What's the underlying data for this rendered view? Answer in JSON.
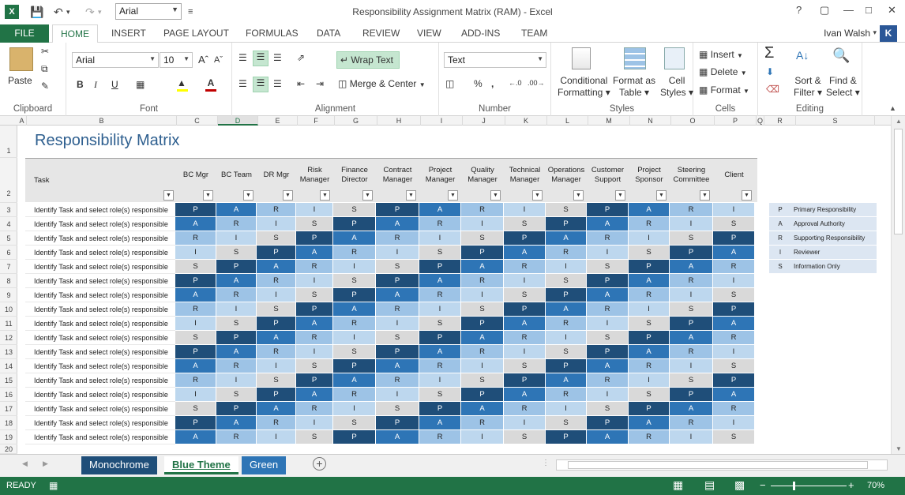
{
  "window": {
    "title": "Responsibility Assignment Matrix (RAM) - Excel",
    "help": "?",
    "restore": "▢",
    "minimize": "—",
    "maximize": "□",
    "close": "✕"
  },
  "namebox": {
    "value": "Arial"
  },
  "qat": {
    "app_icon": "X"
  },
  "ribbon_tabs": [
    {
      "label": "FILE"
    },
    {
      "label": "HOME"
    },
    {
      "label": "INSERT"
    },
    {
      "label": "PAGE LAYOUT"
    },
    {
      "label": "FORMULAS"
    },
    {
      "label": "DATA"
    },
    {
      "label": "REVIEW"
    },
    {
      "label": "VIEW"
    },
    {
      "label": "ADD-INS"
    },
    {
      "label": "TEAM"
    }
  ],
  "user": {
    "name": "Ivan Walsh",
    "initial": "K"
  },
  "groups": {
    "clipboard": {
      "label": "Clipboard",
      "paste": "Paste"
    },
    "font": {
      "label": "Font",
      "family": "Arial",
      "size": "10",
      "bold": "B",
      "italic": "I",
      "underline": "U"
    },
    "alignment": {
      "label": "Alignment",
      "wrap": "Wrap Text",
      "merge": "Merge & Center"
    },
    "number": {
      "label": "Number",
      "format": "Text",
      "percent": "%",
      "comma": ","
    },
    "styles": {
      "label": "Styles",
      "conditional": "Conditional",
      "conditional2": "Formatting",
      "format_table": "Format as",
      "format_table2": "Table",
      "cell_styles": "Cell",
      "cell_styles2": "Styles"
    },
    "cells": {
      "label": "Cells",
      "insert": "Insert",
      "delete": "Delete",
      "format": "Format"
    },
    "editing": {
      "label": "Editing",
      "sort": "Sort &",
      "sort2": "Filter",
      "find": "Find &",
      "find2": "Select"
    }
  },
  "columns": [
    "A",
    "B",
    "C",
    "D",
    "E",
    "F",
    "G",
    "H",
    "I",
    "J",
    "K",
    "L",
    "M",
    "N",
    "O",
    "P",
    "Q",
    "R",
    "S"
  ],
  "rows": [
    "1",
    "2",
    "3",
    "4",
    "5",
    "6",
    "7",
    "8",
    "9",
    "10",
    "11",
    "12",
    "13",
    "14",
    "15",
    "16",
    "17",
    "18",
    "19",
    "20"
  ],
  "sheet": {
    "title": "Responsibility Matrix",
    "task_header": "Task",
    "roles": [
      {
        "l1": "",
        "l2": "BC Mgr"
      },
      {
        "l1": "",
        "l2": "BC Team"
      },
      {
        "l1": "",
        "l2": "DR Mgr"
      },
      {
        "l1": "Risk",
        "l2": "Manager"
      },
      {
        "l1": "Finance",
        "l2": "Director"
      },
      {
        "l1": "Contract",
        "l2": "Manager"
      },
      {
        "l1": "Project",
        "l2": "Manager"
      },
      {
        "l1": "Quality",
        "l2": "Manager"
      },
      {
        "l1": "Technical",
        "l2": "Manager"
      },
      {
        "l1": "Operations",
        "l2": "Manager"
      },
      {
        "l1": "Customer",
        "l2": "Support"
      },
      {
        "l1": "Project",
        "l2": "Sponsor"
      },
      {
        "l1": "Steering",
        "l2": "Committee"
      },
      {
        "l1": "",
        "l2": "Client"
      }
    ],
    "tasks": [
      "Identify Task and select role(s) responsible",
      "Identify Task and select role(s) responsible",
      "Identify Task and select role(s) responsible",
      "Identify Task and select role(s) responsible",
      "Identify Task and select role(s) responsible",
      "Identify Task and select role(s) responsible",
      "Identify Task and select role(s) responsible",
      "Identify Task and select role(s) responsible",
      "Identify Task and select role(s) responsible",
      "Identify Task and select role(s) responsible",
      "Identify Task and select role(s) responsible",
      "Identify Task and select role(s) responsible",
      "Identify Task and select role(s) responsible",
      "Identify Task and select role(s) responsible",
      "Identify Task and select role(s) responsible",
      "Identify Task and select role(s) responsible",
      "Identify Task and select role(s) responsible"
    ],
    "pattern": [
      "P",
      "A",
      "R",
      "I",
      "S"
    ],
    "legend": [
      {
        "code": "P",
        "label": "Primary Responsibility"
      },
      {
        "code": "A",
        "label": "Approval Authority"
      },
      {
        "code": "R",
        "label": "Supporting Responsibility"
      },
      {
        "code": "I",
        "label": "Reviewer"
      },
      {
        "code": "S",
        "label": "Information Only"
      }
    ],
    "colors": {
      "P": "#1f4e79",
      "A": "#2e75b6",
      "R": "#9dc3e6",
      "I": "#bdd7ee",
      "S": "#d9d9d9"
    }
  },
  "sheet_tabs": [
    {
      "label": "Monochrome",
      "color": "#1f4e79"
    },
    {
      "label": "Blue Theme",
      "color": "#ffffff"
    },
    {
      "label": "Green",
      "color": "#2e75b6"
    }
  ],
  "status": {
    "ready": "READY",
    "zoom": "70%"
  }
}
